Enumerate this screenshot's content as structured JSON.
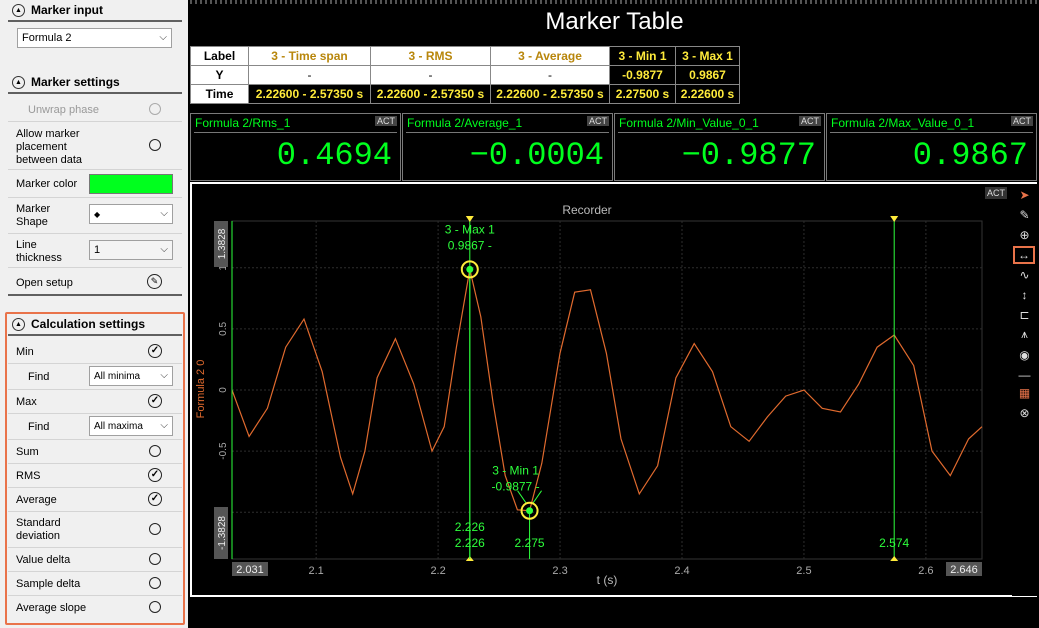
{
  "marker_input": {
    "title": "Marker input",
    "source": "Formula 2"
  },
  "marker_settings": {
    "title": "Marker settings",
    "unwrap_phase": "Unwrap phase",
    "allow_placement": "Allow marker placement between data",
    "marker_color_label": "Marker color",
    "marker_color": "#00ff1e",
    "marker_shape_label": "Marker Shape",
    "marker_shape_value": "◆",
    "line_thickness_label": "Line thickness",
    "line_thickness_value": "1",
    "open_setup": "Open setup"
  },
  "calc_settings": {
    "title": "Calculation settings",
    "min": "Min",
    "min_find_label": "Find",
    "min_find_value": "All minima",
    "max": "Max",
    "max_find_label": "Find",
    "max_find_value": "All maxima",
    "sum": "Sum",
    "rms": "RMS",
    "average": "Average",
    "std": "Standard deviation",
    "value_delta": "Value delta",
    "sample_delta": "Sample delta",
    "average_slope": "Average slope"
  },
  "marker_table": {
    "title": "Marker Table",
    "headers": [
      "Label",
      "3 - Time span",
      "3 - RMS",
      "3 - Average",
      "3 - Min 1",
      "3 - Max 1"
    ],
    "y_row": [
      "Y",
      "-",
      "-",
      "-",
      "-0.9877",
      "0.9867"
    ],
    "time_row": [
      "Time",
      "2.22600 - 2.57350 s",
      "2.22600 - 2.57350 s",
      "2.22600 - 2.57350 s",
      "2.27500 s",
      "2.22600 s"
    ]
  },
  "value_panels": [
    {
      "name": "Formula 2/Rms_1",
      "value": "0.4694",
      "act": "ACT"
    },
    {
      "name": "Formula 2/Average_1",
      "value": "−0.0004",
      "act": "ACT"
    },
    {
      "name": "Formula 2/Min_Value_0_1",
      "value": "−0.9877",
      "act": "ACT"
    },
    {
      "name": "Formula 2/Max_Value_0_1",
      "value": "0.9867",
      "act": "ACT"
    }
  ],
  "recorder": {
    "title": "Recorder",
    "act": "ACT",
    "ylabel": "Formula 2 0",
    "xlabel": "t (s)",
    "y_top_label": "1.3828",
    "y_bottom_label": "-1.3828",
    "x_left_label": "2.031",
    "x_right_label": "2.646",
    "ytick_labels": [
      "1",
      "0.5",
      "0",
      "-0.5",
      "-1"
    ],
    "xtick_labels": [
      "2.1",
      "2.2",
      "2.3",
      "2.4",
      "2.5",
      "2.6"
    ],
    "max_marker_label": "3 - Max 1",
    "max_marker_value": "0.9867 -",
    "min_marker_label": "3 - Min 1",
    "min_marker_value": "-0.9877 -",
    "cursor1_labels": [
      "2.226",
      "2.226"
    ],
    "cursor_min_label": "2.275",
    "cursor2_label": "2.574",
    "signal_color": "#e06a2e",
    "marker_color": "#2dff3c"
  },
  "chart_data": {
    "type": "line",
    "title": "Recorder",
    "xlabel": "t (s)",
    "ylabel": "Formula 2 0",
    "xlim": [
      2.031,
      2.646
    ],
    "ylim": [
      -1.3828,
      1.3828
    ],
    "series": [
      {
        "x": [
          2.031,
          2.045,
          2.06,
          2.075,
          2.09,
          2.105,
          2.12,
          2.13,
          2.14,
          2.15,
          2.165,
          2.18,
          2.195,
          2.205,
          2.215,
          2.226,
          2.235,
          2.245,
          2.255,
          2.265,
          2.275,
          2.285,
          2.3,
          2.312,
          2.325,
          2.338,
          2.35,
          2.365,
          2.38,
          2.395,
          2.41,
          2.425,
          2.44,
          2.455,
          2.47,
          2.485,
          2.5,
          2.515,
          2.53,
          2.545,
          2.56,
          2.574,
          2.59,
          2.605,
          2.62,
          2.635,
          2.646
        ],
        "y": [
          0.0,
          -0.38,
          -0.15,
          0.35,
          0.58,
          0.15,
          -0.55,
          -0.85,
          -0.5,
          0.1,
          0.42,
          0.05,
          -0.5,
          -0.3,
          0.35,
          0.9867,
          0.6,
          -0.1,
          -0.7,
          -0.98,
          -0.9877,
          -0.6,
          0.3,
          0.8,
          0.82,
          0.3,
          -0.4,
          -0.85,
          -0.62,
          0.1,
          0.38,
          0.15,
          -0.3,
          -0.42,
          -0.22,
          -0.05,
          0.0,
          -0.15,
          -0.18,
          0.05,
          0.35,
          0.45,
          0.2,
          -0.5,
          -0.7,
          -0.4,
          -0.3
        ]
      }
    ],
    "markers": [
      {
        "label": "3 - Max 1",
        "x": 2.226,
        "y": 0.9867
      },
      {
        "label": "3 - Min 1",
        "x": 2.275,
        "y": -0.9877
      }
    ],
    "cursors": [
      2.226,
      2.574
    ]
  }
}
